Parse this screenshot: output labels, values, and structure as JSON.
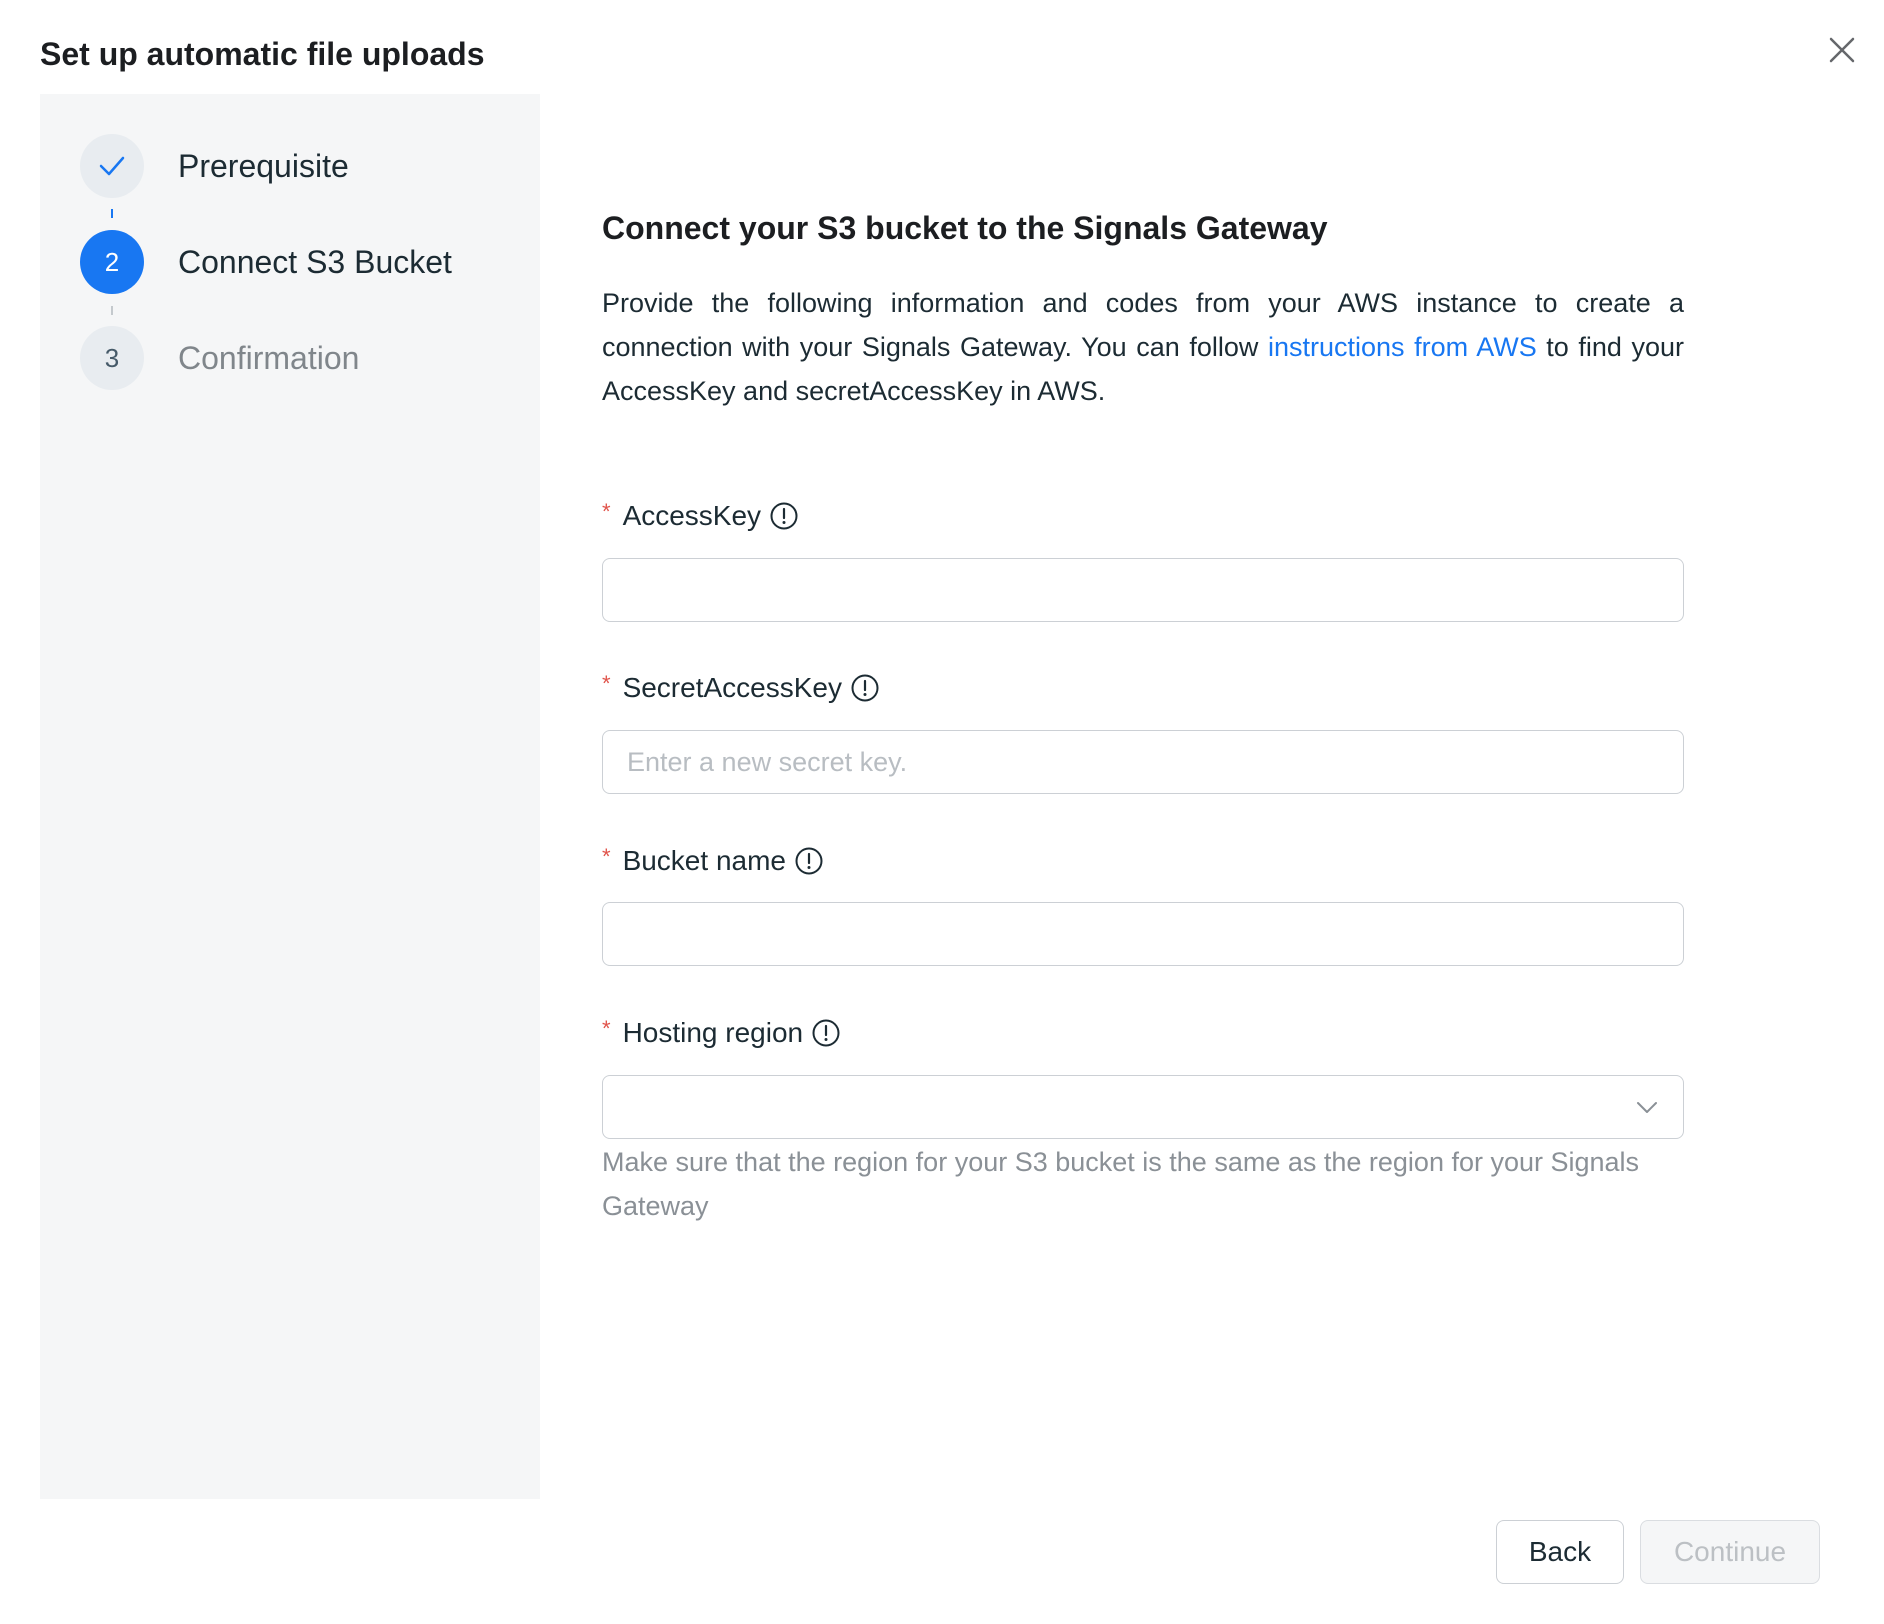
{
  "dialog": {
    "title": "Set up automatic file uploads"
  },
  "steps": [
    {
      "label": "Prerequisite",
      "status": "done"
    },
    {
      "number": "2",
      "label": "Connect S3 Bucket",
      "status": "active"
    },
    {
      "number": "3",
      "label": "Confirmation",
      "status": "pending"
    }
  ],
  "main": {
    "heading": "Connect your S3 bucket to the Signals Gateway",
    "description_before_link": "Provide the following information and codes from your AWS instance to create a connection with your Signals Gateway. You can follow ",
    "link_text": "instructions from AWS",
    "description_after_link": " to find your AccessKey and secretAccessKey in AWS."
  },
  "form": {
    "required_mark": "*",
    "access_key": {
      "label": "AccessKey",
      "value": "",
      "placeholder": ""
    },
    "secret_access_key": {
      "label": "SecretAccessKey",
      "value": "",
      "placeholder": "Enter a new secret key."
    },
    "bucket_name": {
      "label": "Bucket name",
      "value": "",
      "placeholder": ""
    },
    "hosting_region": {
      "label": "Hosting region",
      "selected": "",
      "helper": "Make sure that the region for your S3 bucket is the same as the region for your Signals Gateway"
    }
  },
  "footer": {
    "back_label": "Back",
    "continue_label": "Continue"
  },
  "colors": {
    "accent": "#1877f2",
    "required": "#e0534a",
    "sidebar_bg": "#f5f6f7"
  }
}
